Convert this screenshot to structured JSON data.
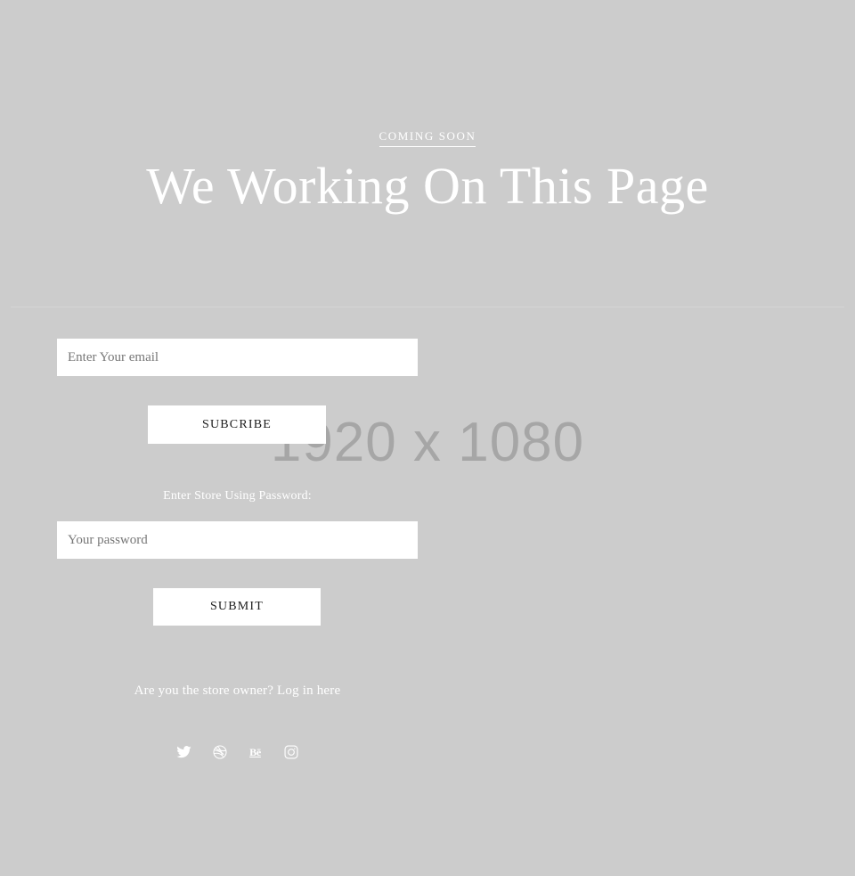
{
  "page": {
    "background_color": "#cccccc",
    "text_color": "#ffffff",
    "watermark": "1920 x 1080"
  },
  "hero": {
    "eyebrow": "COMING SOON",
    "title": "We Working On This Page"
  },
  "signup": {
    "email_placeholder": "Enter Your email",
    "email_value": "",
    "subscribe_label": "SUBCRIBE"
  },
  "store_access": {
    "label": "Enter Store Using Password:",
    "password_placeholder": "Your password",
    "password_value": "",
    "submit_label": "SUBMIT"
  },
  "owner": {
    "text": "Are you the store owner? Log in here"
  },
  "socials": [
    {
      "name": "twitter",
      "label": "Twitter"
    },
    {
      "name": "dribbble",
      "label": "Dribbble"
    },
    {
      "name": "behance",
      "label": "Behance",
      "glyph": "Bē"
    },
    {
      "name": "instagram",
      "label": "Instagram"
    }
  ]
}
